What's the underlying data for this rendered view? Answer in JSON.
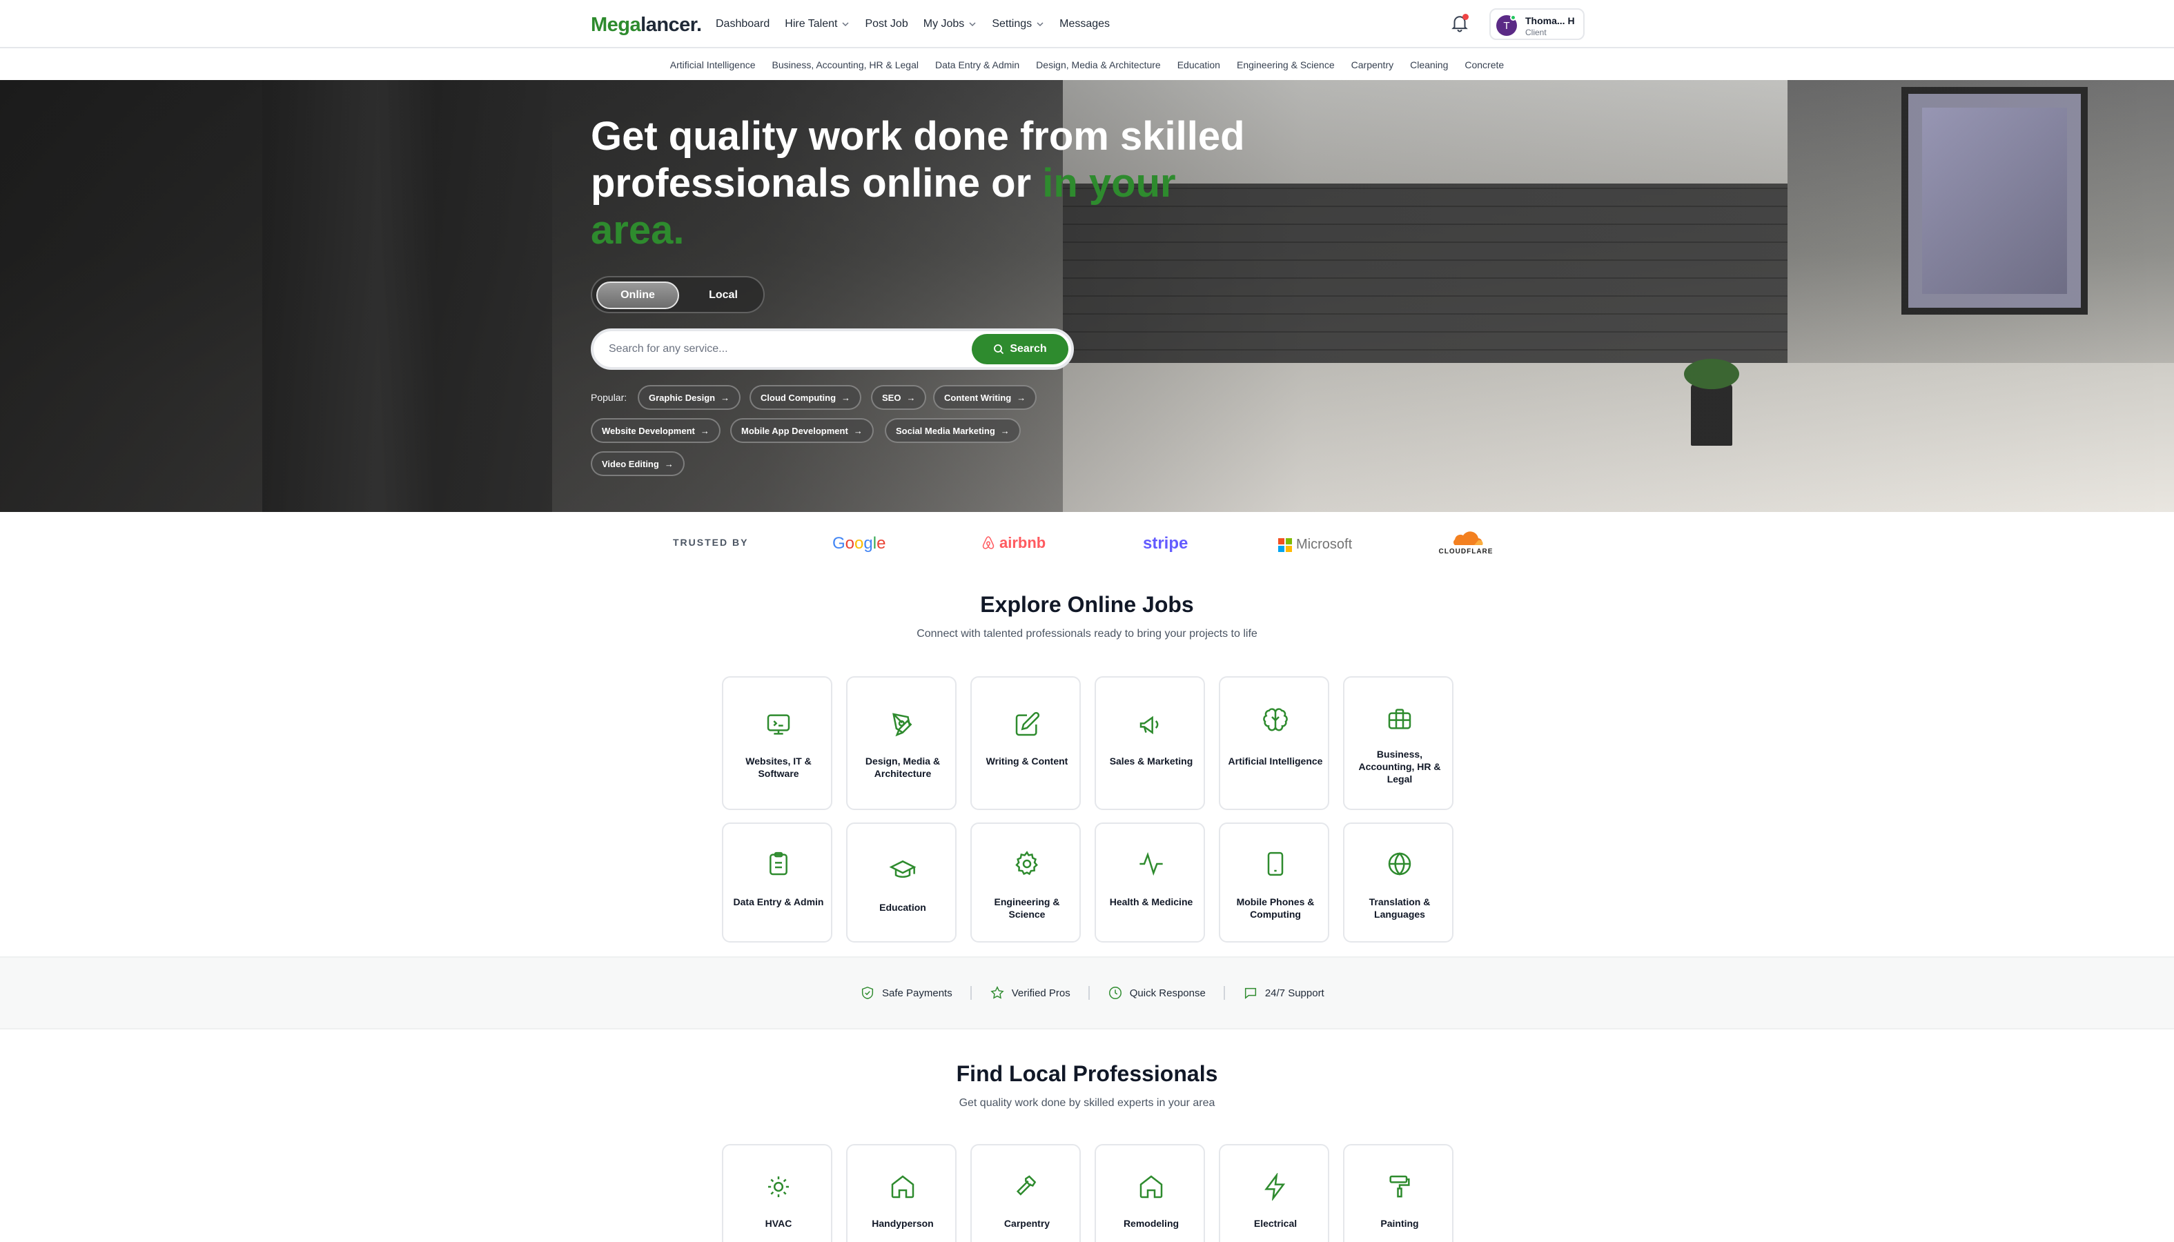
{
  "brand": {
    "name_part1": "Mega",
    "name_part2": "lancer."
  },
  "nav": {
    "items": [
      {
        "label": "Dashboard"
      },
      {
        "label": "Hire Talent"
      },
      {
        "label": "Post Job"
      },
      {
        "label": "My Jobs"
      },
      {
        "label": "Settings"
      },
      {
        "label": "Messages"
      }
    ]
  },
  "user": {
    "initial": "T",
    "name": "Thoma... H",
    "role": "Client"
  },
  "categories": [
    "Artificial Intelligence",
    "Business, Accounting, HR & Legal",
    "Data Entry & Admin",
    "Design, Media & Architecture",
    "Education",
    "Engineering & Science",
    "Carpentry",
    "Cleaning",
    "Concrete"
  ],
  "hero": {
    "headline_main": "Get quality work done from skilled professionals online or ",
    "headline_accent": "in your area.",
    "toggle": {
      "online": "Online",
      "local": "Local"
    },
    "search_placeholder": "Search for any service...",
    "search_button": "Search",
    "popular_label": "Popular:",
    "popular_tags": [
      "Graphic Design",
      "Cloud Computing",
      "SEO",
      "Content Writing",
      "Website Development",
      "Mobile App Development",
      "Social Media Marketing",
      "Video Editing"
    ],
    "arrow": "→"
  },
  "trusted": {
    "label": "TRUSTED BY",
    "logos": {
      "google": "Google",
      "airbnb": "airbnb",
      "stripe": "stripe",
      "microsoft": "Microsoft",
      "cloudflare": "CLOUDFLARE"
    }
  },
  "online_jobs": {
    "title": "Explore Online Jobs",
    "subtitle": "Connect with talented professionals ready to bring your projects to life",
    "cards": [
      {
        "label": "Websites, IT & Software",
        "icon": "monitor-code-icon"
      },
      {
        "label": "Design, Media & Architecture",
        "icon": "pen-tool-icon"
      },
      {
        "label": "Writing & Content",
        "icon": "pencil-square-icon"
      },
      {
        "label": "Sales & Marketing",
        "icon": "megaphone-icon"
      },
      {
        "label": "Artificial Intelligence",
        "icon": "brain-icon"
      },
      {
        "label": "Business, Accounting, HR & Legal",
        "icon": "briefcase-icon"
      },
      {
        "label": "Data Entry & Admin",
        "icon": "clipboard-icon"
      },
      {
        "label": "Education",
        "icon": "graduation-cap-icon"
      },
      {
        "label": "Engineering & Science",
        "icon": "gear-icon"
      },
      {
        "label": "Health & Medicine",
        "icon": "pulse-icon"
      },
      {
        "label": "Mobile Phones & Computing",
        "icon": "smartphone-icon"
      },
      {
        "label": "Translation & Languages",
        "icon": "globe-icon"
      }
    ]
  },
  "trust_strip": [
    "Safe Payments",
    "Verified Pros",
    "Quick Response",
    "24/7 Support"
  ],
  "local_pros": {
    "title": "Find Local Professionals",
    "subtitle": "Get quality work done by skilled experts in your area",
    "cards": [
      {
        "label": "HVAC",
        "icon": "sun-icon"
      },
      {
        "label": "Handyperson",
        "icon": "home-icon"
      },
      {
        "label": "Carpentry",
        "icon": "hammer-icon"
      },
      {
        "label": "Remodeling",
        "icon": "home-icon"
      },
      {
        "label": "Electrical",
        "icon": "lightning-icon"
      },
      {
        "label": "Painting",
        "icon": "paint-roller-icon"
      }
    ]
  },
  "colors": {
    "accent": "#2e8b2e",
    "text": "#111827",
    "muted": "#4b5563",
    "border": "#e5e7eb"
  }
}
